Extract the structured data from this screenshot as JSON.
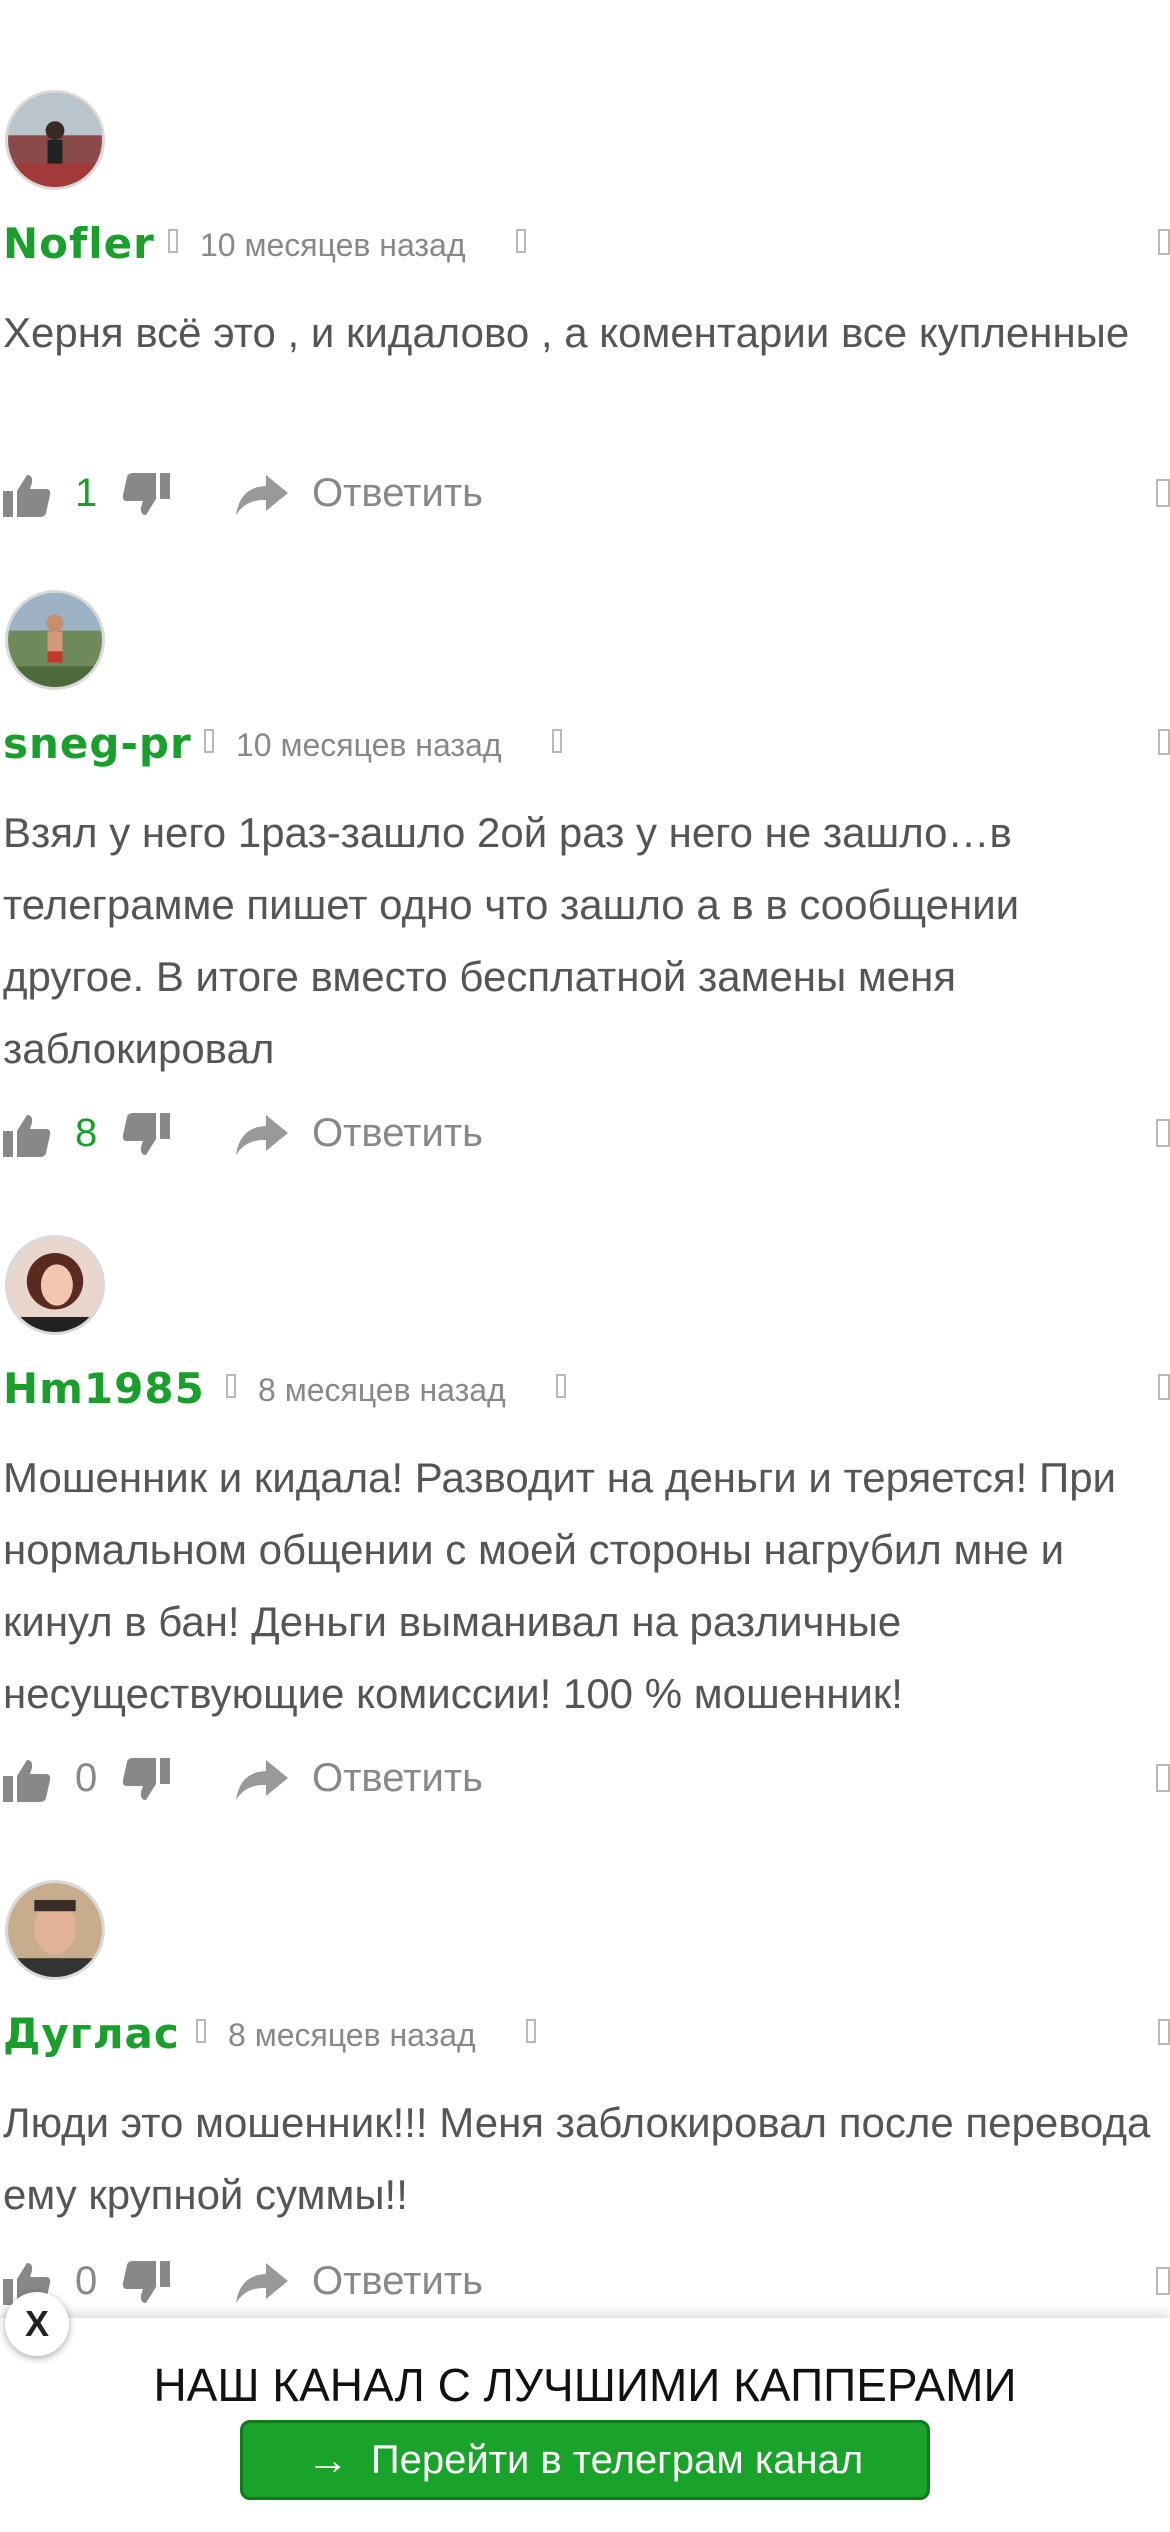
{
  "comments": [
    {
      "author": "Nofler",
      "time": "10 месяцев назад",
      "text": "Херня всё это , и кидалово , а коментарии все купленные",
      "likes": "1",
      "reply_label": "Ответить"
    },
    {
      "author": "sneg-pr",
      "time": "10 месяцев назад",
      "text": "Взял у него 1раз-зашло 2ой раз у него не зашло…в телеграмме пишет одно что зашло а в в сообщении другое. В итоге вместо бесплатной замены меня заблокировал",
      "likes": "8",
      "reply_label": "Ответить"
    },
    {
      "author": "Hm1985",
      "time": "8 месяцев назад",
      "text": "Мошенник и кидала! Разводит на деньги и теряется! При нормальном общении с моей стороны нагрубил мне и кинул в бан! Деньги выманивал на различные несуществующие комиссии! 100 % мошенник!",
      "likes": "0",
      "reply_label": "Ответить"
    },
    {
      "author": "Дуглас",
      "time": "8 месяцев назад",
      "text": "Люди это мошенник!!! Меня заблокировал после перевода ему крупной суммы!!",
      "likes": "0",
      "reply_label": "Ответить"
    }
  ],
  "banner": {
    "title": "НАШ КАНАЛ С ЛУЧШИМИ КАППЕРАМИ",
    "button_label": "Перейти в телеграм канал",
    "button_icon": "arrow-right-icon",
    "close_label": "X"
  },
  "colors": {
    "author": "#1a9e2c",
    "button": "#1aa32a",
    "text": "#555555",
    "muted": "#888888"
  }
}
